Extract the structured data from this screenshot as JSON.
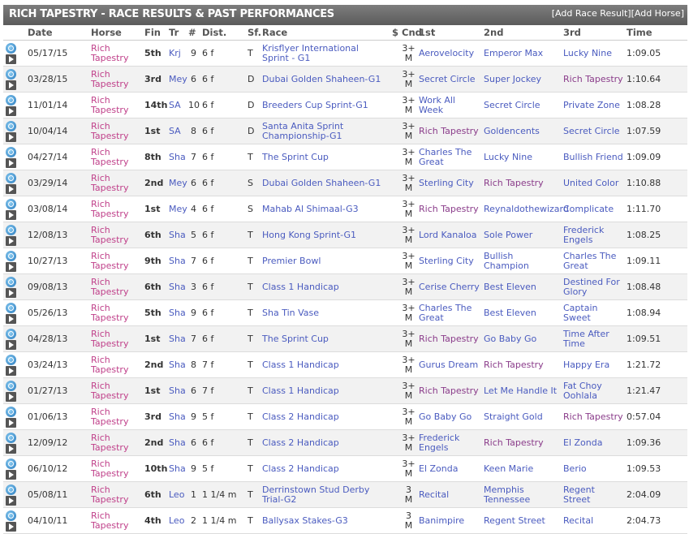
{
  "header": {
    "title": "RICH TAPESTRY - RACE RESULTS & PAST PERFORMANCES",
    "add_race_result": "[Add Race Result]",
    "add_horse": "[Add Horse]"
  },
  "columns": [
    "Date",
    "Horse",
    "Fin",
    "Tr",
    "#",
    "Dist.",
    "Sf.",
    "Race",
    "$",
    "Cnd",
    "1st",
    "2nd",
    "3rd",
    "Time"
  ],
  "rows": [
    {
      "date": "05/17/15",
      "horse": "Rich Tapestry",
      "fin": "5th",
      "tr": "Krj",
      "num": "9",
      "dist": "6 f",
      "sf": "T",
      "race": "Krisflyer International Sprint - G1",
      "cnd": "3+ M",
      "first": "Aerovelocity",
      "second": "Emperor Max",
      "third": "Lucky Nine",
      "time": "1:09.05"
    },
    {
      "date": "03/28/15",
      "horse": "Rich Tapestry",
      "fin": "3rd",
      "tr": "Mey",
      "num": "6",
      "dist": "6 f",
      "sf": "D",
      "race": "Dubai Golden Shaheen-G1",
      "cnd": "3+ M",
      "first": "Secret Circle",
      "second": "Super Jockey",
      "third": "Rich Tapestry",
      "time": "1:10.64"
    },
    {
      "date": "11/01/14",
      "horse": "Rich Tapestry",
      "fin": "14th",
      "tr": "SA",
      "num": "10",
      "dist": "6 f",
      "sf": "D",
      "race": "Breeders Cup Sprint-G1",
      "cnd": "3+ M",
      "first": "Work All Week",
      "second": "Secret Circle",
      "third": "Private Zone",
      "time": "1:08.28"
    },
    {
      "date": "10/04/14",
      "horse": "Rich Tapestry",
      "fin": "1st",
      "tr": "SA",
      "num": "8",
      "dist": "6 f",
      "sf": "D",
      "race": "Santa Anita Sprint Championship-G1",
      "cnd": "3+ M",
      "first": "Rich Tapestry",
      "second": "Goldencents",
      "third": "Secret Circle",
      "time": "1:07.59"
    },
    {
      "date": "04/27/14",
      "horse": "Rich Tapestry",
      "fin": "8th",
      "tr": "Sha",
      "num": "7",
      "dist": "6 f",
      "sf": "T",
      "race": "The Sprint Cup",
      "cnd": "3+ M",
      "first": "Charles The Great",
      "second": "Lucky Nine",
      "third": "Bullish Friend",
      "time": "1:09.09"
    },
    {
      "date": "03/29/14",
      "horse": "Rich Tapestry",
      "fin": "2nd",
      "tr": "Mey",
      "num": "6",
      "dist": "6 f",
      "sf": "S",
      "race": "Dubai Golden Shaheen-G1",
      "cnd": "3+ M",
      "first": "Sterling City",
      "second": "Rich Tapestry",
      "third": "United Color",
      "time": "1:10.88"
    },
    {
      "date": "03/08/14",
      "horse": "Rich Tapestry",
      "fin": "1st",
      "tr": "Mey",
      "num": "4",
      "dist": "6 f",
      "sf": "S",
      "race": "Mahab Al Shimaal-G3",
      "cnd": "3+ M",
      "first": "Rich Tapestry",
      "second": "Reynaldothewizard",
      "third": "Complicate",
      "time": "1:11.70"
    },
    {
      "date": "12/08/13",
      "horse": "Rich Tapestry",
      "fin": "6th",
      "tr": "Sha",
      "num": "5",
      "dist": "6 f",
      "sf": "T",
      "race": "Hong Kong Sprint-G1",
      "cnd": "3+ M",
      "first": "Lord Kanaloa",
      "second": "Sole Power",
      "third": "Frederick Engels",
      "time": "1:08.25"
    },
    {
      "date": "10/27/13",
      "horse": "Rich Tapestry",
      "fin": "9th",
      "tr": "Sha",
      "num": "7",
      "dist": "6 f",
      "sf": "T",
      "race": "Premier Bowl",
      "cnd": "3+ M",
      "first": "Sterling City",
      "second": "Bullish Champion",
      "third": "Charles The Great",
      "time": "1:09.11"
    },
    {
      "date": "09/08/13",
      "horse": "Rich Tapestry",
      "fin": "6th",
      "tr": "Sha",
      "num": "3",
      "dist": "6 f",
      "sf": "T",
      "race": "Class 1 Handicap",
      "cnd": "3+ M",
      "first": "Cerise Cherry",
      "second": "Best Eleven",
      "third": "Destined For Glory",
      "time": "1:08.48"
    },
    {
      "date": "05/26/13",
      "horse": "Rich Tapestry",
      "fin": "5th",
      "tr": "Sha",
      "num": "9",
      "dist": "6 f",
      "sf": "T",
      "race": "Sha Tin Vase",
      "cnd": "3+ M",
      "first": "Charles The Great",
      "second": "Best Eleven",
      "third": "Captain Sweet",
      "time": "1:08.94"
    },
    {
      "date": "04/28/13",
      "horse": "Rich Tapestry",
      "fin": "1st",
      "tr": "Sha",
      "num": "7",
      "dist": "6 f",
      "sf": "T",
      "race": "The Sprint Cup",
      "cnd": "3+ M",
      "first": "Rich Tapestry",
      "second": "Go Baby Go",
      "third": "Time After Time",
      "time": "1:09.51"
    },
    {
      "date": "03/24/13",
      "horse": "Rich Tapestry",
      "fin": "2nd",
      "tr": "Sha",
      "num": "8",
      "dist": "7 f",
      "sf": "T",
      "race": "Class 1 Handicap",
      "cnd": "3+ M",
      "first": "Gurus Dream",
      "second": "Rich Tapestry",
      "third": "Happy Era",
      "time": "1:21.72"
    },
    {
      "date": "01/27/13",
      "horse": "Rich Tapestry",
      "fin": "1st",
      "tr": "Sha",
      "num": "6",
      "dist": "7 f",
      "sf": "T",
      "race": "Class 1 Handicap",
      "cnd": "3+ M",
      "first": "Rich Tapestry",
      "second": "Let Me Handle It",
      "third": "Fat Choy Oohlala",
      "time": "1:21.47"
    },
    {
      "date": "01/06/13",
      "horse": "Rich Tapestry",
      "fin": "3rd",
      "tr": "Sha",
      "num": "9",
      "dist": "5 f",
      "sf": "T",
      "race": "Class 2 Handicap",
      "cnd": "3+ M",
      "first": "Go Baby Go",
      "second": "Straight Gold",
      "third": "Rich Tapestry",
      "time": "0:57.04"
    },
    {
      "date": "12/09/12",
      "horse": "Rich Tapestry",
      "fin": "2nd",
      "tr": "Sha",
      "num": "6",
      "dist": "6 f",
      "sf": "T",
      "race": "Class 2 Handicap",
      "cnd": "3+ M",
      "first": "Frederick Engels",
      "second": "Rich Tapestry",
      "third": "El Zonda",
      "time": "1:09.36"
    },
    {
      "date": "06/10/12",
      "horse": "Rich Tapestry",
      "fin": "10th",
      "tr": "Sha",
      "num": "9",
      "dist": "5 f",
      "sf": "T",
      "race": "Class 2 Handicap",
      "cnd": "3+ M",
      "first": "El Zonda",
      "second": "Keen Marie",
      "third": "Berio",
      "time": "1:09.53"
    },
    {
      "date": "05/08/11",
      "horse": "Rich Tapestry",
      "fin": "6th",
      "tr": "Leo",
      "num": "1",
      "dist": "1 1/4 m",
      "sf": "T",
      "race": "Derrinstown Stud Derby Trial-G2",
      "cnd": "3 M",
      "first": "Recital",
      "second": "Memphis Tennessee",
      "third": "Regent Street",
      "time": "2:04.09"
    },
    {
      "date": "04/10/11",
      "horse": "Rich Tapestry",
      "fin": "4th",
      "tr": "Leo",
      "num": "2",
      "dist": "1 1/4 m",
      "sf": "T",
      "race": "Ballysax Stakes-G3",
      "cnd": "3 M",
      "first": "Banimpire",
      "second": "Regent Street",
      "third": "Recital",
      "time": "2:04.73"
    }
  ]
}
